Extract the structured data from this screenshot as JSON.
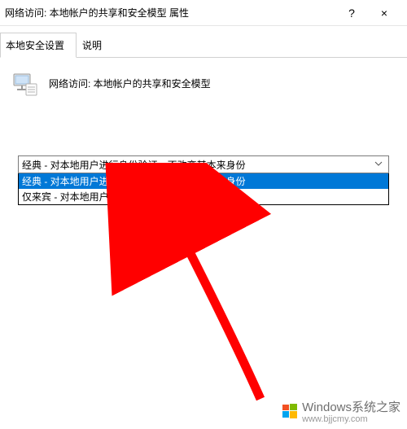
{
  "titlebar": {
    "title": "网络访问: 本地帐户的共享和安全模型 属性",
    "help": "?",
    "close": "×"
  },
  "tabs": {
    "active": "本地安全设置",
    "inactive": "说明"
  },
  "policy": {
    "heading": "网络访问: 本地帐户的共享和安全模型"
  },
  "dropdown": {
    "selected_display": "经典 - 对本地用户进行身份验证，不改变其本来身份",
    "options": [
      "经典 - 对本地用户进行身份验证，不改变其本来身份",
      "仅来宾 - 对本地用户进行身份验证，其身份为来宾"
    ]
  },
  "watermark": {
    "brand": "Windows系统之家",
    "url": "www.bjjcmy.com"
  }
}
